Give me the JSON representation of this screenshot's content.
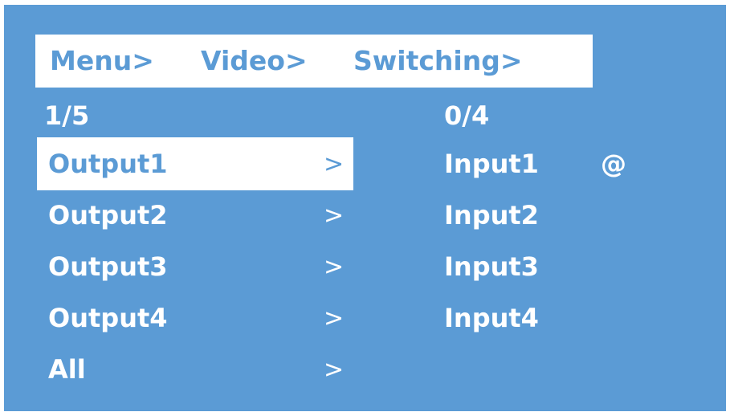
{
  "breadcrumb": {
    "items": [
      "Menu>",
      "Video>",
      "Switching>"
    ]
  },
  "outputs": {
    "page_indicator": "1/5",
    "selected_index": 0,
    "items": [
      {
        "label": "Output1",
        "arrow": ">"
      },
      {
        "label": "Output2",
        "arrow": ">"
      },
      {
        "label": "Output3",
        "arrow": ">"
      },
      {
        "label": "Output4",
        "arrow": ">"
      },
      {
        "label": "All",
        "arrow": ">"
      }
    ]
  },
  "inputs": {
    "page_indicator": "0/4",
    "items": [
      {
        "label": "Input1",
        "marker": "@"
      },
      {
        "label": "Input2",
        "marker": ""
      },
      {
        "label": "Input3",
        "marker": ""
      },
      {
        "label": "Input4",
        "marker": ""
      }
    ]
  },
  "colors": {
    "background": "#5b9bd5",
    "highlight": "#ffffff",
    "text": "#ffffff"
  }
}
